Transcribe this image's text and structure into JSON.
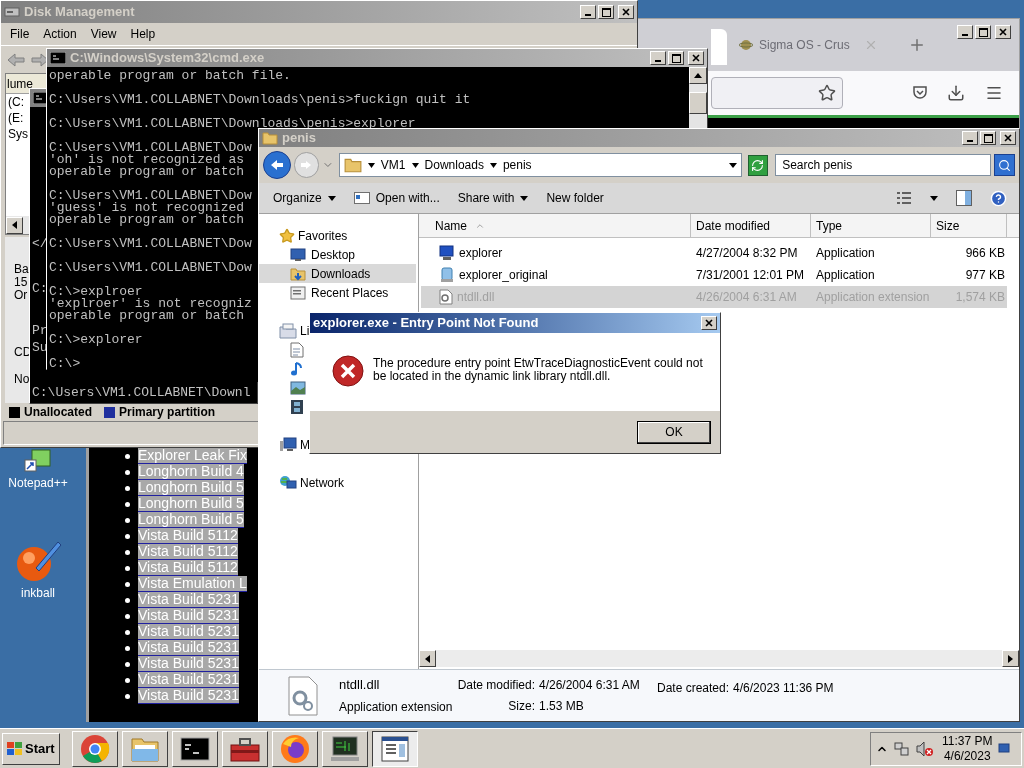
{
  "browser": {
    "tab": {
      "label": "Sigma OS - Crus"
    }
  },
  "disk_management": {
    "title": "Disk Management",
    "menu": [
      "File",
      "Action",
      "View",
      "Help"
    ],
    "volume_header": "lume",
    "volumes": [
      "(C:",
      "(E:",
      "Sys"
    ],
    "disk_labels": [
      "Ba",
      "15",
      "Or"
    ],
    "other_labels": [
      "CD",
      "No"
    ],
    "legend": [
      {
        "label": "Unallocated",
        "color": "#000000"
      },
      {
        "label": "Primary partition",
        "color": "#1f2f9e"
      }
    ]
  },
  "cmd_back": {
    "strip": [
      "</",
      "C:",
      "Pr",
      "Su"
    ],
    "last_line": "C:\\Users\\VM1.COLLABNET\\Downl"
  },
  "web_list": {
    "items": [
      "Explorer Leak Fix",
      "Longhorn Build 4",
      "Longhorn Build 5",
      "Longhorn Build 5",
      "Longhorn Build 5",
      "Vista Build 5112",
      "Vista Build 5112",
      "Vista Build 5112",
      "Vista Emulation L",
      "Vista Build 5231",
      "Vista Build 5231",
      "Vista Build 5231",
      "Vista Build 5231",
      "Vista Build 5231",
      "Vista Build 5231",
      "Vista Build 5231"
    ]
  },
  "cmd": {
    "title": "C:\\Windows\\System32\\cmd.exe",
    "blocks": [
      [
        "operable program or batch file."
      ],
      [
        "C:\\Users\\VM1.COLLABNET\\Downloads\\penis>fuckign quit it"
      ],
      [
        "C:\\Users\\VM1.COLLABNET\\Downloads\\penis>explorer"
      ],
      [
        "C:\\Users\\VM1.COLLABNET\\Dow",
        "'oh' is not recognized as",
        "operable program or batch"
      ],
      [
        "C:\\Users\\VM1.COLLABNET\\Dow",
        "'guess' is not recognized",
        "operable program or batch"
      ],
      [
        "C:\\Users\\VM1.COLLABNET\\Dow"
      ],
      [
        "C:\\Users\\VM1.COLLABNET\\Dow"
      ],
      [
        "C:\\>explroer",
        "'explroer' is not recogniz",
        "operable program or batch"
      ],
      [
        "C:\\>explorer"
      ],
      [
        "C:\\>"
      ]
    ]
  },
  "explorer": {
    "title": "penis",
    "path": [
      "VM1",
      "Downloads",
      "penis"
    ],
    "search": {
      "placeholder": "Search penis"
    },
    "toolbar": [
      {
        "label": "Organize",
        "dropdown": true
      },
      {
        "label": "Open with...",
        "dropdown": false
      },
      {
        "label": "Share with",
        "dropdown": true
      },
      {
        "label": "New folder",
        "dropdown": false
      }
    ],
    "nav": [
      {
        "label": "Favorites",
        "kind": "favorites",
        "selected": false,
        "children": [
          {
            "label": "Desktop",
            "kind": "desktop",
            "selected": false
          },
          {
            "label": "Downloads",
            "kind": "downloads",
            "selected": true
          },
          {
            "label": "Recent Places",
            "kind": "recent",
            "selected": false
          }
        ]
      },
      {
        "label": "Li",
        "kind": "libraries",
        "selected": false,
        "children": [
          {
            "kind": "documents",
            "selected": false
          },
          {
            "kind": "music",
            "selected": false
          },
          {
            "kind": "pictures",
            "selected": false
          },
          {
            "kind": "videos",
            "selected": false
          }
        ]
      },
      {
        "label": "M",
        "kind": "computer",
        "selected": false
      },
      {
        "label": "Network",
        "kind": "network",
        "selected": false
      }
    ],
    "columns": [
      "Name",
      "Date modified",
      "Type",
      "Size"
    ],
    "files": [
      {
        "name": "explorer",
        "kind": "monitor",
        "date": "4/27/2004 8:32 PM",
        "type": "Application",
        "size": "966 KB",
        "selected": false
      },
      {
        "name": "explorer_original",
        "kind": "app",
        "date": "7/31/2001 12:01 PM",
        "type": "Application",
        "size": "977 KB",
        "selected": false
      },
      {
        "name": "ntdll.dll",
        "kind": "dll",
        "date": "4/26/2004 6:31 AM",
        "type": "Application extension",
        "size": "1,574 KB",
        "selected": true
      }
    ],
    "details": {
      "name": "ntdll.dll",
      "type": "Application extension",
      "modified_label": "Date modified:",
      "modified": "4/26/2004 6:31 AM",
      "size_label": "Size:",
      "size": "1.53 MB",
      "created_label": "Date created:",
      "created": "4/6/2023 11:36 PM"
    }
  },
  "dialog": {
    "title": "explorer.exe - Entry Point Not Found",
    "message": "The procedure entry point EtwTraceDiagnosticEvent could not be located in the dynamic link library ntdll.dll.",
    "button": "OK"
  },
  "desktop_icons": [
    {
      "label": "Notepad++",
      "kind": "notepad"
    },
    {
      "label": "inkball",
      "kind": "inkball"
    }
  ],
  "taskbar": {
    "start": "Start",
    "items": [
      {
        "kind": "chrome",
        "selected": false
      },
      {
        "kind": "folder",
        "selected": false
      },
      {
        "kind": "cmd",
        "selected": false
      },
      {
        "kind": "toolbox",
        "selected": false
      },
      {
        "kind": "firefox",
        "selected": false
      },
      {
        "kind": "diskmgmt",
        "selected": false
      },
      {
        "kind": "window",
        "selected": true
      }
    ],
    "time": "11:37 PM",
    "date": "4/6/2023"
  }
}
